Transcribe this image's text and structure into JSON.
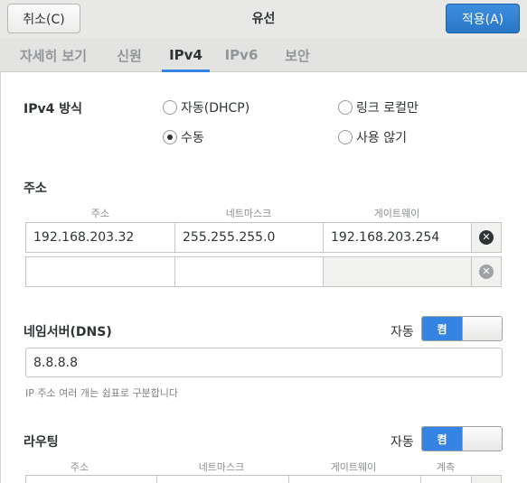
{
  "header": {
    "cancel_label": "취소(C)",
    "title": "유선",
    "apply_label": "적용(A)"
  },
  "tabs": [
    {
      "label": "자세히 보기",
      "active": false
    },
    {
      "label": "신원",
      "active": false
    },
    {
      "label": "IPv4",
      "active": true
    },
    {
      "label": "IPv6",
      "active": false
    },
    {
      "label": "보안",
      "active": false
    }
  ],
  "ipv4_method": {
    "label": "IPv4 방식",
    "options": [
      {
        "label": "자동(DHCP)",
        "checked": false
      },
      {
        "label": "링크 로컬만",
        "checked": false
      },
      {
        "label": "수동",
        "checked": true
      },
      {
        "label": "사용 않기",
        "checked": false
      }
    ]
  },
  "addresses": {
    "label": "주소",
    "columns": [
      "주소",
      "네트마스크",
      "게이트웨이"
    ],
    "rows": [
      {
        "address": "192.168.203.32",
        "netmask": "255.255.255.0",
        "gateway": "192.168.203.254"
      },
      {
        "address": "",
        "netmask": "",
        "gateway": ""
      }
    ]
  },
  "dns": {
    "label": "네임서버(DNS)",
    "auto_label": "자동",
    "switch_label": "켬",
    "value": "8.8.8.8",
    "hint": "IP 주소 여러 개는 쉼표로 구분합니다"
  },
  "routes": {
    "label": "라우팅",
    "auto_label": "자동",
    "switch_label": "켬",
    "columns": [
      "주소",
      "네트마스크",
      "게이트웨이",
      "계측"
    ]
  },
  "colors": {
    "accent": "#3584e4",
    "apply_button": "#2a76c6"
  }
}
